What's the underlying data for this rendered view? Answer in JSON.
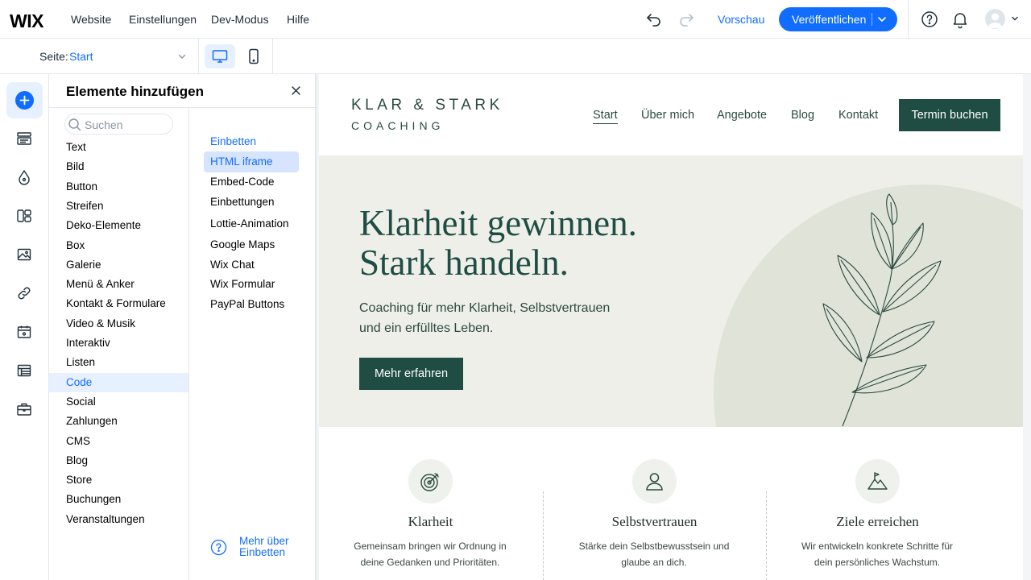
{
  "topbar": {
    "logo": "WIX",
    "menu": [
      "Website",
      "Einstellungen",
      "Dev-Modus",
      "Hilfe"
    ],
    "preview": "Vorschau",
    "publish": "Veröffentlichen"
  },
  "pagebar": {
    "label": "Seite:",
    "value": "Start"
  },
  "panel": {
    "title": "Elemente hinzufügen",
    "search_placeholder": "Suchen",
    "categories": [
      "Text",
      "Bild",
      "Button",
      "Streifen",
      "Deko-Elemente",
      "Box",
      "Galerie",
      "Menü & Anker",
      "Kontakt & Formulare",
      "Video & Musik",
      "Interaktiv",
      "Listen",
      "Code",
      "Social",
      "Zahlungen",
      "CMS",
      "Blog",
      "Store",
      "Buchungen",
      "Veranstaltungen"
    ],
    "active_category": "Code",
    "sub_heading": "Einbetten",
    "sub_items": [
      "HTML iframe",
      "Embed-Code",
      "Einbettungen",
      "Lottie-Animation",
      "Google Maps",
      "Wix Chat",
      "Wix Formular",
      "PayPal Buttons"
    ],
    "active_sub": "HTML iframe",
    "more_link": "Mehr über Einbetten"
  },
  "site": {
    "brand_line1": "KLAR & STARK",
    "brand_line2": "COACHING",
    "nav": [
      "Start",
      "Über mich",
      "Angebote",
      "Blog",
      "Kontakt"
    ],
    "cta": "Termin buchen",
    "hero_title": "Klarheit gewinnen.\nStark handeln.",
    "hero_text": "Coaching für mehr Klarheit, Selbstvertrauen und ein erfülltes Leben.",
    "hero_button": "Mehr erfahren",
    "features": [
      {
        "title": "Klarheit",
        "text": "Gemeinsam bringen wir Ordnung in deine Gedanken und Prioritäten.",
        "icon": "target-icon"
      },
      {
        "title": "Selbstvertrauen",
        "text": "Stärke dein Selbstbewusstsein und glaube an dich.",
        "icon": "person-icon"
      },
      {
        "title": "Ziele erreichen",
        "text": "Wir entwickeln konkrete Schritte für dein persönliches Wachstum.",
        "icon": "mountain-flag-icon"
      }
    ]
  },
  "colors": {
    "accent": "#116dff",
    "brand_green": "#1f4d43",
    "hero_bg": "#efefe9"
  }
}
